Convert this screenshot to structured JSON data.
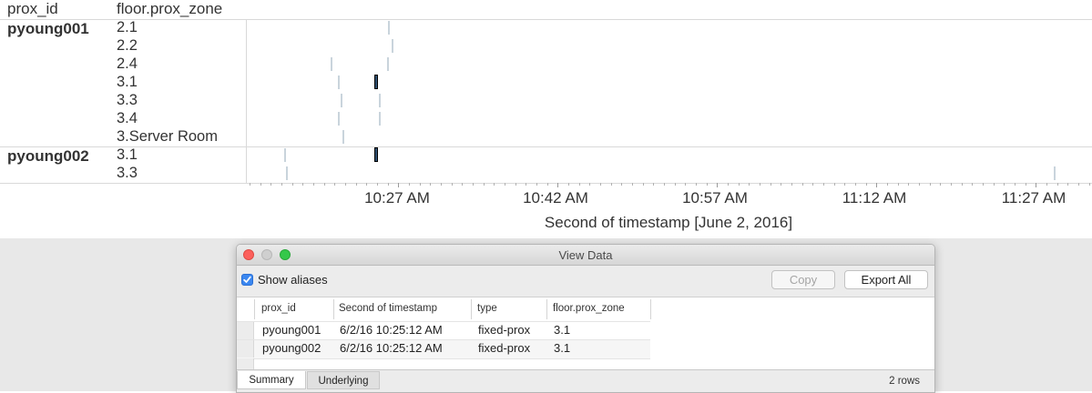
{
  "viz": {
    "col_headers": {
      "prox_id": "prox_id",
      "zone": "floor.prox_zone"
    },
    "groups": [
      {
        "prox_id": "pyoung001",
        "zones": [
          "2.1",
          "2.2",
          "2.4",
          "3.1",
          "3.3",
          "3.4",
          "3.Server Room"
        ]
      },
      {
        "prox_id": "pyoung002",
        "zones": [
          "3.1",
          "3.3"
        ]
      }
    ],
    "axis": {
      "ticks": [
        "10:27 AM",
        "10:42 AM",
        "10:57 AM",
        "11:12 AM",
        "11:27 AM"
      ],
      "title": "Second of timestamp [June 2, 2016]"
    }
  },
  "window": {
    "title": "View Data",
    "show_aliases_label": "Show aliases",
    "show_aliases_checked": true,
    "copy_label": "Copy",
    "export_label": "Export All",
    "table": {
      "columns": [
        "prox_id",
        "Second of timestamp",
        "type",
        "floor.prox_zone"
      ],
      "rows": [
        [
          "pyoung001",
          "6/2/16 10:25:12 AM",
          "fixed-prox",
          "3.1"
        ],
        [
          "pyoung002",
          "6/2/16 10:25:12 AM",
          "fixed-prox",
          "3.1"
        ]
      ]
    },
    "tabs": [
      "Summary",
      "Underlying"
    ],
    "row_count": "2 rows"
  },
  "colors": {
    "mark": "#c9d4dc",
    "selected_mark": "#2f4f6f",
    "checkbox": "#3b87f0",
    "close": "#fc605c",
    "minimize": "#fdbc40",
    "zoom": "#34c84a"
  }
}
